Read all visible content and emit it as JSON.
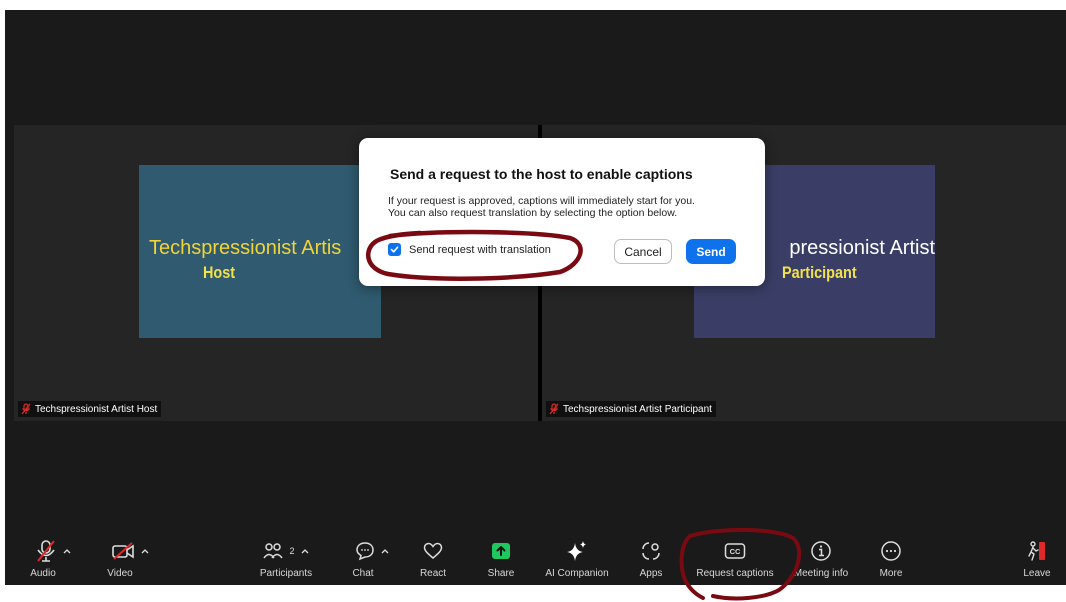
{
  "tiles": {
    "host": {
      "card_name": "Techspressionist Artis",
      "card_role": "Host",
      "label": "Techspressionist Artist Host"
    },
    "participant": {
      "card_name": "pressionist Artist",
      "card_role": "Participant",
      "label": "Techspressionist Artist Participant"
    }
  },
  "modal": {
    "title": "Send a request to the host to enable captions",
    "body_line1": "If your request is approved, captions will immediately start for you.",
    "body_line2": "You can also request translation by selecting the option below.",
    "checkbox_label": "Send request with translation",
    "checkbox_checked": true,
    "cancel_label": "Cancel",
    "send_label": "Send"
  },
  "toolbar": {
    "audio": "Audio",
    "video": "Video",
    "participants": "Participants",
    "participants_count": "2",
    "chat": "Chat",
    "react": "React",
    "share": "Share",
    "ai_companion": "AI Companion",
    "apps": "Apps",
    "request_captions": "Request captions",
    "meeting_info": "Meeting info",
    "more": "More",
    "leave": "Leave"
  },
  "colors": {
    "background": "#1a1a1a",
    "accent_blue": "#0e72ed",
    "share_green": "#1fc75f",
    "mute_red": "#e02828",
    "annotation": "#7a0a12"
  }
}
